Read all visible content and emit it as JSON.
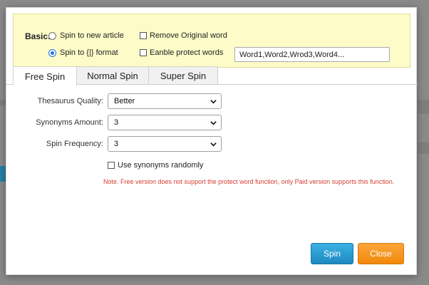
{
  "basic": {
    "label": "Basic:",
    "options": {
      "spin_new_article": {
        "label": "Spin to new article",
        "checked": false
      },
      "spin_format": {
        "label": "Spin to {|} format",
        "checked": true
      },
      "remove_original": {
        "label": "Remove Original word",
        "checked": false
      },
      "protect_words": {
        "label": "Eanble protect words",
        "checked": false
      }
    },
    "protect_input": {
      "value": "Word1,Word2,Wrod3,Word4..."
    }
  },
  "tabs": [
    {
      "label": "Free Spin",
      "active": true
    },
    {
      "label": "Normal Spin",
      "active": false
    },
    {
      "label": "Super Spin",
      "active": false
    }
  ],
  "form": {
    "thesaurus_quality": {
      "label": "Thesaurus Quality:",
      "value": "Better"
    },
    "synonyms_amount": {
      "label": "Synonyms Amount:",
      "value": "3"
    },
    "spin_frequency": {
      "label": "Spin Frequency:",
      "value": "3"
    },
    "use_random": {
      "label": "Use synonyms randomly",
      "checked": false
    }
  },
  "note": "Note. Free version does not support the protect word function, only Paid version supports this function.",
  "buttons": {
    "spin": "Spin",
    "close": "Close"
  },
  "colors": {
    "note": "#d33c2f",
    "spin_button": "#1e90c8",
    "close_button": "#f5921b",
    "basic_panel": "#fdfbc8"
  }
}
